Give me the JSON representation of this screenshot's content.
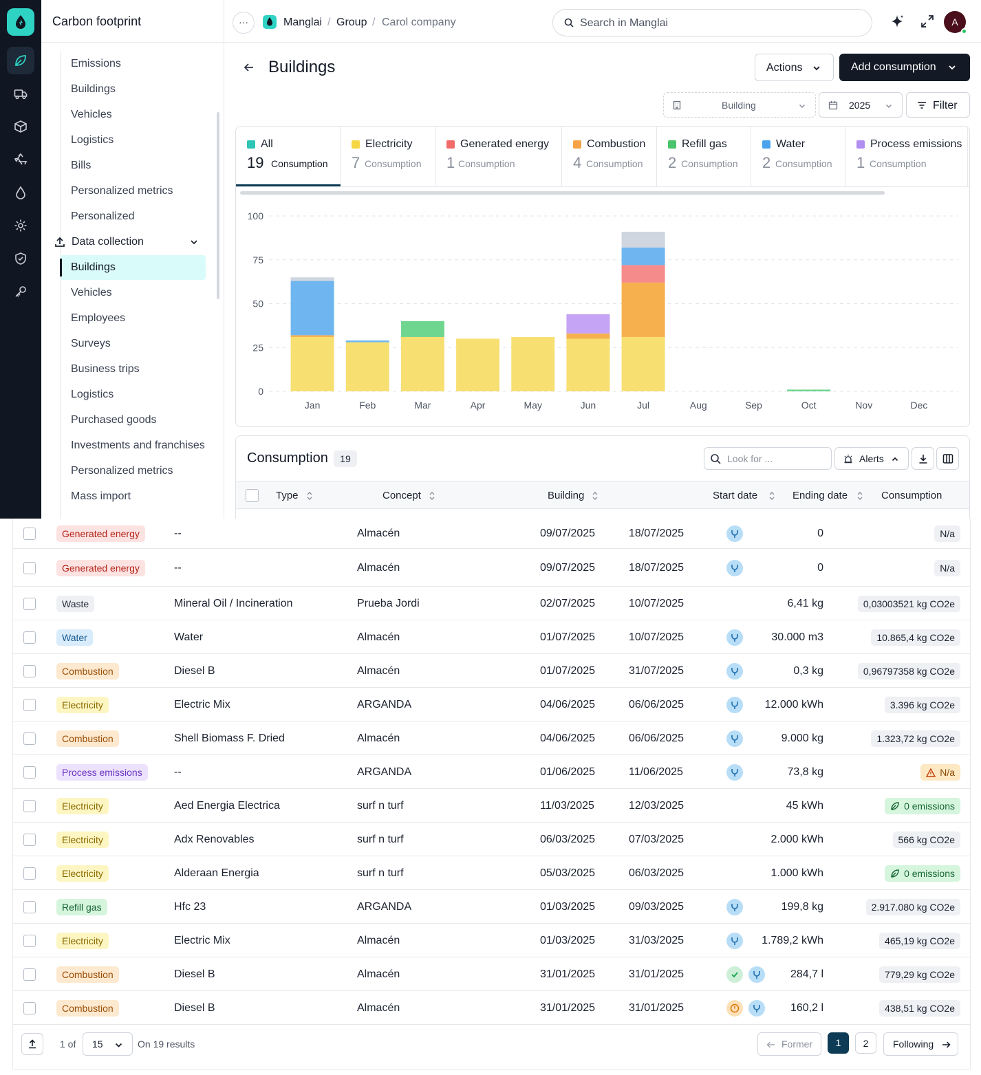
{
  "colors": {
    "brand": "#2fd3c4",
    "rail_bg": "#101722",
    "primary_button": "#131a26",
    "active_nav": "#d9fbfa"
  },
  "rail": {
    "icons": [
      "logo-icon",
      "leaf-icon",
      "truck-icon",
      "box-icon",
      "recycle-icon",
      "drop-icon",
      "gear-icon",
      "shield-icon",
      "key-icon"
    ]
  },
  "sidebar": {
    "title": "Carbon footprint",
    "items": [
      "Emissions",
      "Buildings",
      "Vehicles",
      "Logistics",
      "Bills",
      "Personalized metrics",
      "Personalized"
    ],
    "section": {
      "label": "Data collection",
      "icon": "upload-icon"
    },
    "sub_items": [
      "Buildings",
      "Vehicles",
      "Employees",
      "Surveys",
      "Business trips",
      "Logistics",
      "Purchased goods",
      "Investments and franchises",
      "Personalized metrics",
      "Mass import"
    ],
    "active_sub_item": "Buildings"
  },
  "topbar": {
    "more_label": "···",
    "breadcrumb": [
      "Manglai",
      "Group",
      "Carol company"
    ],
    "breadcrumb_sep": "/",
    "search_placeholder": "Search in Manglai",
    "avatar_initial": "A"
  },
  "header": {
    "title": "Buildings",
    "actions_label": "Actions",
    "add_label": "Add consumption",
    "building_filter": "Building",
    "year": "2025",
    "filter_label": "Filter"
  },
  "categories": [
    {
      "name": "All",
      "count": "19",
      "label": "Consumption",
      "color": "#2ec4b6",
      "active": true
    },
    {
      "name": "Electricity",
      "count": "7",
      "label": "Consumption",
      "color": "#f6d743"
    },
    {
      "name": "Generated energy",
      "count": "1",
      "label": "Consumption",
      "color": "#f26b6b"
    },
    {
      "name": "Combustion",
      "count": "4",
      "label": "Consumption",
      "color": "#f6a348"
    },
    {
      "name": "Refill gas",
      "count": "2",
      "label": "Consumption",
      "color": "#49c46a"
    },
    {
      "name": "Water",
      "count": "2",
      "label": "Consumption",
      "color": "#4aa3ec"
    },
    {
      "name": "Process emissions",
      "count": "1",
      "label": "Consumption",
      "color": "#b28ef2"
    }
  ],
  "chart_data": {
    "type": "bar",
    "stacked": true,
    "categories": [
      "Jan",
      "Feb",
      "Mar",
      "Apr",
      "May",
      "Jun",
      "Jul",
      "Aug",
      "Sep",
      "Oct",
      "Nov",
      "Dec"
    ],
    "ylim": [
      0,
      100
    ],
    "yticks": [
      0,
      25,
      50,
      75,
      100
    ],
    "grid": true,
    "series": [
      {
        "name": "Electricity",
        "color": "#f7df72",
        "values": [
          31,
          28,
          31,
          30,
          31,
          30,
          31,
          0,
          0,
          0,
          0,
          0
        ]
      },
      {
        "name": "Combustion",
        "color": "#f6b04e",
        "values": [
          1,
          0,
          0,
          0,
          0,
          3,
          31,
          0,
          0,
          0,
          0,
          0
        ]
      },
      {
        "name": "Generated energy",
        "color": "#f58b8b",
        "values": [
          0,
          0,
          0,
          0,
          0,
          0,
          10,
          0,
          0,
          0,
          0,
          0
        ]
      },
      {
        "name": "Refill gas",
        "color": "#6fd68f",
        "values": [
          0,
          0,
          9,
          0,
          0,
          0,
          0,
          0,
          0,
          1,
          0,
          0
        ]
      },
      {
        "name": "Process emissions",
        "color": "#c5a3f5",
        "values": [
          0,
          0,
          0,
          0,
          0,
          11,
          0,
          0,
          0,
          0,
          0,
          0
        ]
      },
      {
        "name": "Water",
        "color": "#6fb6f0",
        "values": [
          31,
          1,
          0,
          0,
          0,
          0,
          10,
          0,
          0,
          0,
          0,
          0
        ]
      },
      {
        "name": "Waste",
        "color": "#cfd6df",
        "values": [
          2,
          0,
          0,
          0,
          0,
          0,
          9,
          0,
          0,
          0,
          0,
          0
        ]
      }
    ]
  },
  "table": {
    "title": "Consumption",
    "count": "19",
    "search_placeholder": "Look for ...",
    "alerts_label": "Alerts",
    "columns": [
      "Type",
      "Concept",
      "Building",
      "Start date",
      "Ending date",
      "Consumption"
    ],
    "rows": [
      {
        "type": "Generated energy",
        "concept": "--",
        "building": "Almacén",
        "start": "09/07/2025",
        "end": "18/07/2025",
        "source": "source",
        "consumption": "0",
        "emissions": "N/a",
        "em_kind": "na"
      },
      {
        "type": "Generated energy",
        "concept": "--",
        "building": "Almacén",
        "start": "09/07/2025",
        "end": "18/07/2025",
        "source": "source",
        "consumption": "0",
        "emissions": "N/a",
        "em_kind": "na"
      },
      {
        "type": "Waste",
        "concept": "Mineral Oil / Incineration",
        "building": "Prueba Jordi",
        "start": "02/07/2025",
        "end": "10/07/2025",
        "source": "",
        "consumption": "6,41 kg",
        "emissions": "0,03003521 kg CO2e",
        "em_kind": "value"
      },
      {
        "type": "Water",
        "concept": "Water",
        "building": "Almacén",
        "start": "01/07/2025",
        "end": "10/07/2025",
        "source": "source",
        "consumption": "30.000 m3",
        "emissions": "10.865,4 kg CO2e",
        "em_kind": "value"
      },
      {
        "type": "Combustion",
        "concept": "Diesel B",
        "building": "Almacén",
        "start": "01/07/2025",
        "end": "31/07/2025",
        "source": "source",
        "consumption": "0,3 kg",
        "emissions": "0,96797358 kg CO2e",
        "em_kind": "value"
      },
      {
        "type": "Electricity",
        "concept": "Electric Mix",
        "building": "ARGANDA",
        "start": "04/06/2025",
        "end": "06/06/2025",
        "source": "source",
        "consumption": "12.000 kWh",
        "emissions": "3.396 kg CO2e",
        "em_kind": "value"
      },
      {
        "type": "Combustion",
        "concept": "Shell Biomass F. Dried",
        "building": "Almacén",
        "start": "04/06/2025",
        "end": "06/06/2025",
        "source": "source",
        "consumption": "9.000 kg",
        "emissions": "1.323,72 kg CO2e",
        "em_kind": "value"
      },
      {
        "type": "Process emissions",
        "concept": "--",
        "building": "ARGANDA",
        "start": "01/06/2025",
        "end": "11/06/2025",
        "source": "source",
        "consumption": "73,8 kg",
        "emissions": "N/a",
        "em_kind": "nawarn"
      },
      {
        "type": "Electricity",
        "concept": "Aed Energia Electrica",
        "building": "surf n turf",
        "start": "11/03/2025",
        "end": "12/03/2025",
        "source": "",
        "consumption": "45 kWh",
        "emissions": "0 emissions",
        "em_kind": "zero"
      },
      {
        "type": "Electricity",
        "concept": "Adx Renovables",
        "building": "surf n turf",
        "start": "06/03/2025",
        "end": "07/03/2025",
        "source": "",
        "consumption": "2.000 kWh",
        "emissions": "566 kg CO2e",
        "em_kind": "value"
      },
      {
        "type": "Electricity",
        "concept": "Alderaan Energia",
        "building": "surf n turf",
        "start": "05/03/2025",
        "end": "06/03/2025",
        "source": "",
        "consumption": "1.000 kWh",
        "emissions": "0 emissions",
        "em_kind": "zero"
      },
      {
        "type": "Refill gas",
        "concept": "Hfc 23",
        "building": "ARGANDA",
        "start": "01/03/2025",
        "end": "09/03/2025",
        "source": "source",
        "consumption": "199,8 kg",
        "emissions": "2.917.080 kg CO2e",
        "em_kind": "value"
      },
      {
        "type": "Electricity",
        "concept": "Electric Mix",
        "building": "Almacén",
        "start": "01/03/2025",
        "end": "31/03/2025",
        "source": "source",
        "consumption": "1.789,2 kWh",
        "emissions": "465,19 kg CO2e",
        "em_kind": "value"
      },
      {
        "type": "Combustion",
        "concept": "Diesel B",
        "building": "Almacén",
        "start": "31/01/2025",
        "end": "31/01/2025",
        "source": "ok+source",
        "consumption": "284,7 l",
        "emissions": "779,29 kg CO2e",
        "em_kind": "value"
      },
      {
        "type": "Combustion",
        "concept": "Diesel B",
        "building": "Almacén",
        "start": "31/01/2025",
        "end": "31/01/2025",
        "source": "warn+source",
        "consumption": "160,2 l",
        "emissions": "438,51 kg CO2e",
        "em_kind": "value"
      }
    ]
  },
  "tag_colors": {
    "Generated energy": {
      "bg": "#fde2e2",
      "fg": "#b42318"
    },
    "Waste": {
      "bg": "#eef0f3",
      "fg": "#2a3040"
    },
    "Water": {
      "bg": "#d8ecfb",
      "fg": "#175a94"
    },
    "Combustion": {
      "bg": "#fde9cf",
      "fg": "#9a4d05"
    },
    "Electricity": {
      "bg": "#fdf6c3",
      "fg": "#8a6a00"
    },
    "Process emissions": {
      "bg": "#ece2fd",
      "fg": "#6b36c2"
    },
    "Refill gas": {
      "bg": "#d6f5dd",
      "fg": "#166534"
    }
  },
  "pager": {
    "page_text": "1 of",
    "page_size": "15",
    "results_text": "On 19 results",
    "former_label": "Former",
    "pages": [
      "1",
      "2"
    ],
    "current_page": "1",
    "following_label": "Following"
  }
}
